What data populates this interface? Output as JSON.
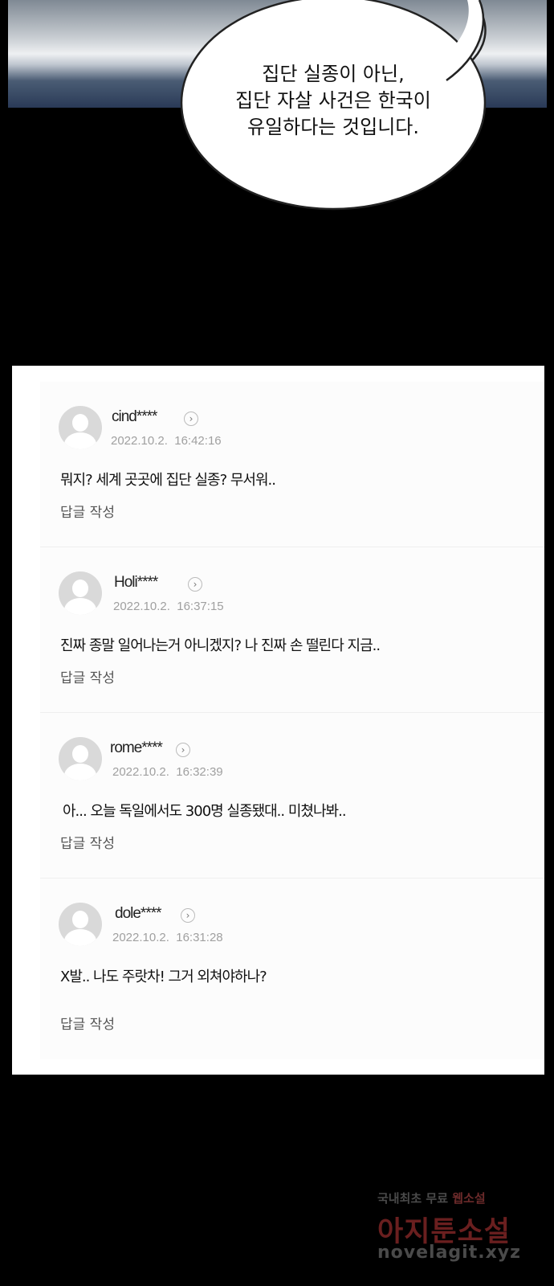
{
  "speech_bubble": {
    "lines": [
      "집단 실종이 아닌,",
      "집단 자살 사건은 한국이",
      "유일하다는 것입니다."
    ]
  },
  "comments": [
    {
      "user": "cind****",
      "date": "2022.10.2.  16:42:16",
      "text": "뭐지? 세계 곳곳에 집단 실종? 무서워..",
      "reply_label": "답글 작성"
    },
    {
      "user": "Holi****",
      "date": "2022.10.2.  16:37:15",
      "text": "진짜 종말 일어나는거 아니겠지? 나 진짜 손 떨린다 지금..",
      "reply_label": "답글 작성"
    },
    {
      "user": "rome****",
      "date": "2022.10.2.  16:32:39",
      "text": "아... 오늘 독일에서도 300명 실종됐대.. 미쳤나봐..",
      "reply_label": "답글 작성"
    },
    {
      "user": "dole****",
      "date": "2022.10.2.  16:31:28",
      "text": "X발.. 나도 주랏차! 그거 외쳐야하나?",
      "reply_label": "답글 작성"
    }
  ],
  "watermark": {
    "line1_a": "국내최초 무료 ",
    "line1_b": "웹소설",
    "line2": "아지툰소설",
    "line3": "novelagit.xyz"
  }
}
